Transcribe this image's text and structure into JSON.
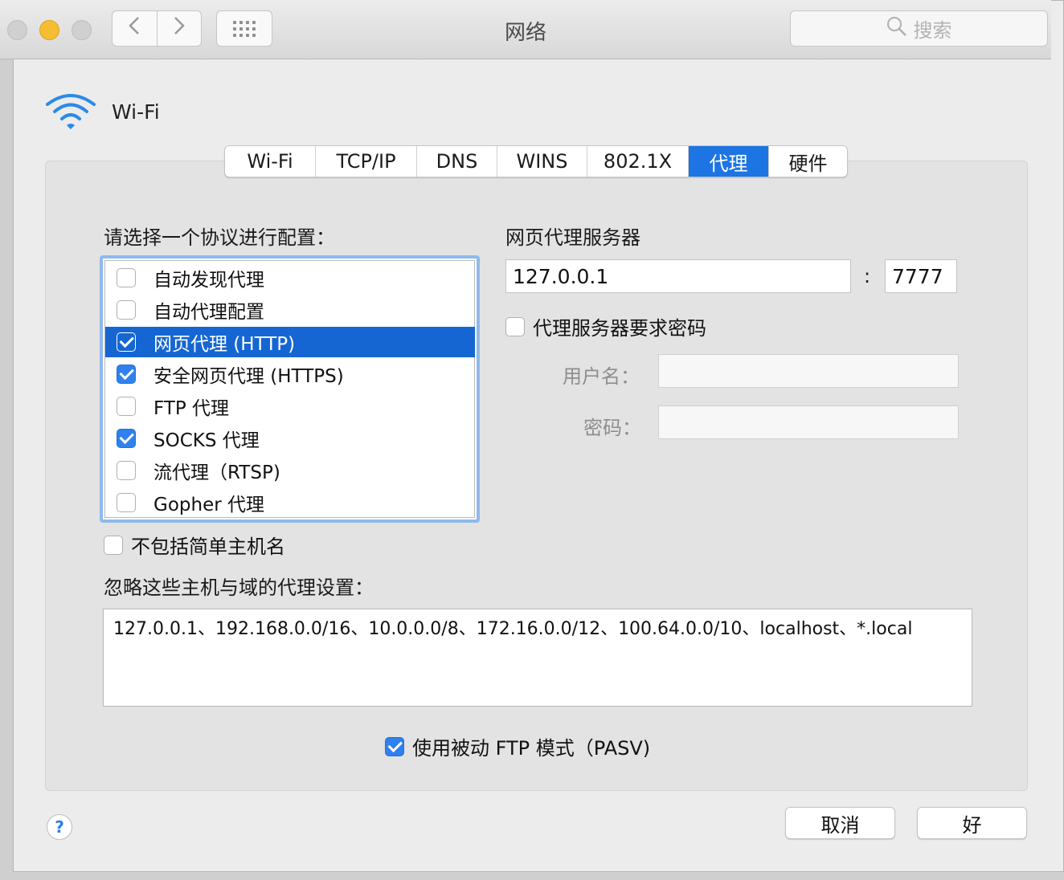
{
  "window": {
    "title": "网络",
    "search_placeholder": "搜索"
  },
  "network": {
    "name": "Wi-Fi"
  },
  "tabs": [
    {
      "label": "Wi-Fi",
      "active": false
    },
    {
      "label": "TCP/IP",
      "active": false
    },
    {
      "label": "DNS",
      "active": false
    },
    {
      "label": "WINS",
      "active": false
    },
    {
      "label": "802.1X",
      "active": false
    },
    {
      "label": "代理",
      "active": true
    },
    {
      "label": "硬件",
      "active": false
    }
  ],
  "protocols": {
    "heading": "请选择一个协议进行配置：",
    "items": [
      {
        "label": "自动发现代理",
        "checked": false,
        "selected": false
      },
      {
        "label": "自动代理配置",
        "checked": false,
        "selected": false
      },
      {
        "label": "网页代理 (HTTP)",
        "checked": true,
        "selected": true
      },
      {
        "label": "安全网页代理 (HTTPS)",
        "checked": true,
        "selected": false
      },
      {
        "label": "FTP 代理",
        "checked": false,
        "selected": false
      },
      {
        "label": "SOCKS 代理",
        "checked": true,
        "selected": false
      },
      {
        "label": "流代理（RTSP)",
        "checked": false,
        "selected": false
      },
      {
        "label": "Gopher 代理",
        "checked": false,
        "selected": false
      }
    ]
  },
  "proxy_server": {
    "heading": "网页代理服务器",
    "host": "127.0.0.1",
    "separator": ":",
    "port": "7777",
    "requires_password_label": "代理服务器要求密码",
    "requires_password": false,
    "username_label": "用户名：",
    "username": "",
    "password_label": "密码：",
    "password": ""
  },
  "exclude_simple": {
    "label": "不包括简单主机名",
    "checked": false
  },
  "bypass": {
    "heading": "忽略这些主机与域的代理设置：",
    "value": "127.0.0.1、192.168.0.0/16、10.0.0.0/8、172.16.0.0/12、100.64.0.0/10、localhost、*.local"
  },
  "pasv": {
    "label": "使用被动 FTP 模式（PASV)",
    "checked": true
  },
  "buttons": {
    "cancel": "取消",
    "ok": "好",
    "help": "?"
  },
  "colors": {
    "accent": "#1d74e3",
    "selection": "#1566d2"
  }
}
